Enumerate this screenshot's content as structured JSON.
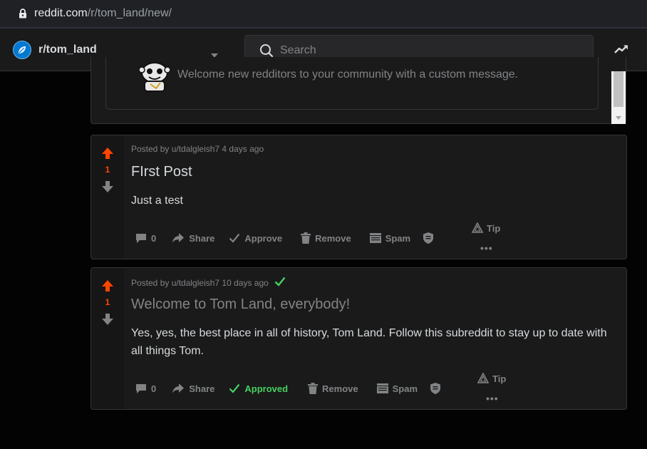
{
  "browser": {
    "url_domain": "reddit.com",
    "url_path": "/r/tom_land/new/"
  },
  "header": {
    "community": "r/tom_land",
    "search_placeholder": "Search"
  },
  "welcome": {
    "message": "Welcome new redditors to your community with a custom message."
  },
  "posts": [
    {
      "votes": "1",
      "meta": "Posted by u/tdalgleish7 4 days ago",
      "title": "FIrst Post",
      "body": "Just a test",
      "actions": {
        "comments": "0",
        "share": "Share",
        "approve": "Approve",
        "remove": "Remove",
        "spam": "Spam",
        "tip": "Tip",
        "more": "•••"
      }
    },
    {
      "votes": "1",
      "meta": "Posted by u/tdalgleish7 10 days ago",
      "title": "Welcome to Tom Land, everybody!",
      "body": "Yes, yes, the best place in all of history, Tom Land. Follow this subreddit to stay up to date with all things Tom.",
      "actions": {
        "comments": "0",
        "share": "Share",
        "approve": "Approved",
        "remove": "Remove",
        "spam": "Spam",
        "tip": "Tip",
        "more": "•••"
      }
    }
  ],
  "colors": {
    "upvote": "#ff4500",
    "approved": "#46d160",
    "background": "#030303",
    "card": "#1a1a1b"
  }
}
